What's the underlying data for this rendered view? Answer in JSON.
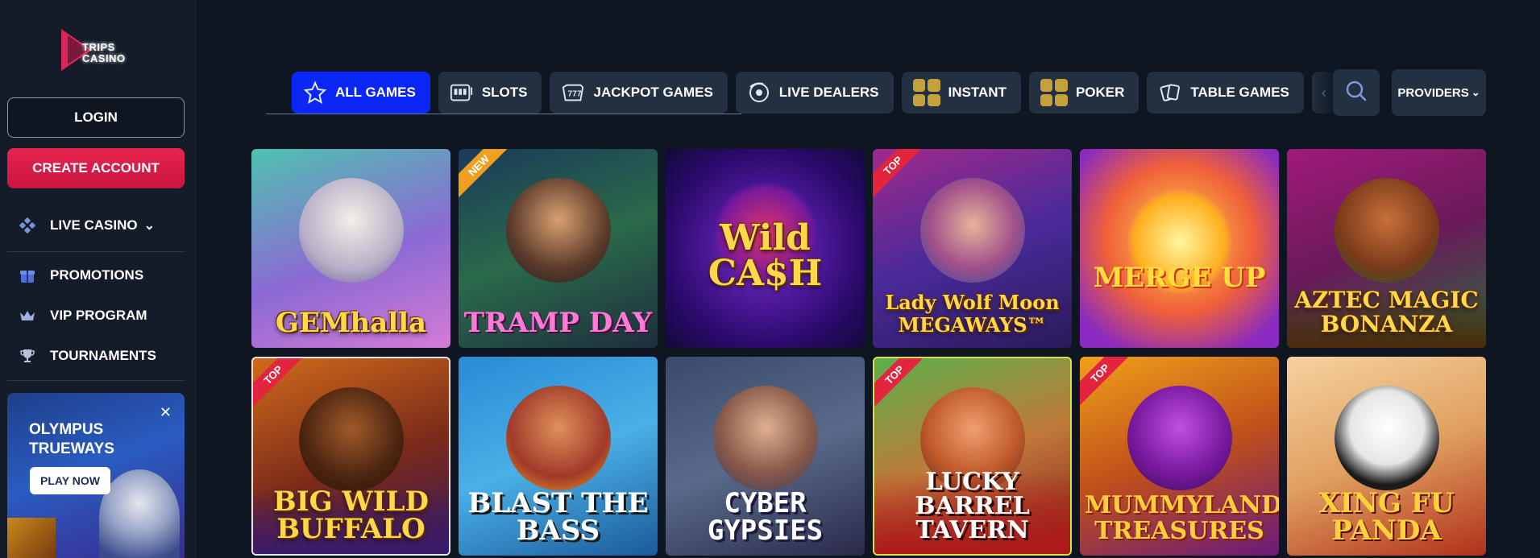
{
  "brand": {
    "logo_text_1": "TRIPS",
    "logo_text_2": "CASINO"
  },
  "auth": {
    "login_label": "LOGIN",
    "create_label": "CREATE ACCOUNT"
  },
  "sidebar": {
    "items": [
      {
        "label": "LIVE CASINO",
        "icon": "live-casino-icon",
        "chevron": "⌄"
      },
      {
        "label": "PROMOTIONS",
        "icon": "gift-icon"
      },
      {
        "label": "VIP PROGRAM",
        "icon": "crown-icon"
      },
      {
        "label": "TOURNAMENTS",
        "icon": "trophy-icon"
      }
    ]
  },
  "promo": {
    "title_1": "OLYMPUS",
    "title_2": "TRUEWAYS",
    "cta": "PLAY NOW",
    "close": "✕"
  },
  "tabs": [
    {
      "label": "ALL GAMES",
      "icon": "star-icon",
      "active": true
    },
    {
      "label": "SLOTS",
      "icon": "slot-machine-icon"
    },
    {
      "label": "JACKPOT GAMES",
      "icon": "jackpot-icon"
    },
    {
      "label": "LIVE DEALERS",
      "icon": "live-dealer-icon"
    },
    {
      "label": "INSTANT",
      "icon": "instant-grid-icon"
    },
    {
      "label": "POKER",
      "icon": "poker-grid-icon"
    },
    {
      "label": "TABLE GAMES",
      "icon": "cards-icon"
    }
  ],
  "toolbar": {
    "providers_label": "PROVIDERS",
    "providers_chevron": "⌄"
  },
  "games": [
    {
      "title": "GEMhalla",
      "badge": ""
    },
    {
      "title": "TRAMP DAY",
      "badge": "NEW"
    },
    {
      "title": "Wild CA$H",
      "badge": ""
    },
    {
      "title": "Lady Wolf Moon MEGAWAYS™",
      "badge": "TOP"
    },
    {
      "title": "MERGE UP",
      "badge": ""
    },
    {
      "title": "AZTEC MAGIC BONANZA",
      "badge": ""
    },
    {
      "title": "BIG WILD BUFFALO",
      "badge": "TOP"
    },
    {
      "title": "BLAST THE BASS",
      "badge": ""
    },
    {
      "title": "CYBER GYPSIES",
      "badge": ""
    },
    {
      "title": "LUCKY BARREL TAVERN",
      "badge": "TOP"
    },
    {
      "title": "MUMMYLAND TREASURES",
      "badge": "TOP"
    },
    {
      "title": "XING FU PANDA",
      "badge": ""
    }
  ],
  "colors": {
    "accent": "#0b27f5",
    "create": "#e8244f",
    "bg": "#0e1621",
    "panel": "#233041"
  }
}
